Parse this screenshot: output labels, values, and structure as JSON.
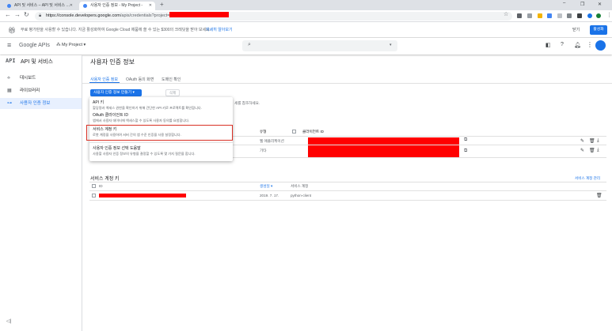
{
  "browser": {
    "tabs": [
      {
        "title": "API 및 서비스 – API 및 서비스 …",
        "active": false
      },
      {
        "title": "사용자 인증 정보 - My Project -",
        "active": true
      }
    ],
    "new_tab_glyph": "+",
    "window_controls": [
      "–",
      "❐",
      "✕"
    ],
    "url_host": "https://console.developers.google.com",
    "url_path": "/apis/credentials?project="
  },
  "banner": {
    "text": "무료 평가판을 사용할 수 있습니다. 지금 활성화하여 Google Cloud 제품에 쓸 수 있는 $300의 크레딧을 받아 보세요.",
    "link": "자세히 알아보기",
    "close_label": "닫기",
    "activate_label": "활성화"
  },
  "header": {
    "logo": "Google APIs",
    "project": "My Project",
    "search_icon": "search-icon"
  },
  "sidebar": {
    "api_badge": "API",
    "title": "API 및 서비스",
    "items": [
      {
        "label": "대시보드",
        "icon": "dashboard-icon",
        "glyph": "⟡"
      },
      {
        "label": "라이브러리",
        "icon": "library-icon",
        "glyph": "▦"
      },
      {
        "label": "사용자 인증 정보",
        "icon": "key-icon",
        "glyph": "⊶"
      }
    ]
  },
  "main": {
    "title": "사용자 인증 정보",
    "tabs": [
      "사용자 인증 정보",
      "OAuth 동의 화면",
      "도메인 확인"
    ],
    "create_button": "사용자 인증 정보 만들기 ▾",
    "delete_button": "삭제",
    "hint_text": "세를 참조하세요."
  },
  "menu": {
    "items": [
      {
        "title": "API 키",
        "desc": "할당량과 액세스 권한을 확인하기 위해 간단한 API 키로 프로젝트를 확인합니다."
      },
      {
        "title": "OAuth 클라이언트 ID",
        "desc": "앱에서 사용자 데이터에 액세스할 수 있도록 사용자 동의를 요청합니다."
      },
      {
        "title": "서비스 계정 키",
        "desc": "로봇 계정을 사용하여 서버 간의 앱 수준 인증을 사용 설정합니다."
      },
      {
        "title": "사용자 인증 정보 선택 도움말",
        "desc": "사용할 사용자 인증 정보의 유형을 결정할 수 있도록 몇 가지 질문을 합니다."
      }
    ]
  },
  "oauth_table": {
    "headers": [
      "유형",
      "클라이언트 ID"
    ],
    "rows": [
      {
        "type": "웹 애플리케이션"
      },
      {
        "type": "기타"
      }
    ]
  },
  "service_accounts": {
    "title": "서비스 계정 키",
    "manage_link": "서비스 계정 관리",
    "headers": [
      "ID",
      "생성일 ▾",
      "서비스 계정"
    ],
    "rows": [
      {
        "date": "2019. 7. 17.",
        "account": "python-client"
      }
    ]
  },
  "colors": {
    "accent": "#1a73e8",
    "redact": "#ff0000",
    "highlight": "#d93025"
  }
}
